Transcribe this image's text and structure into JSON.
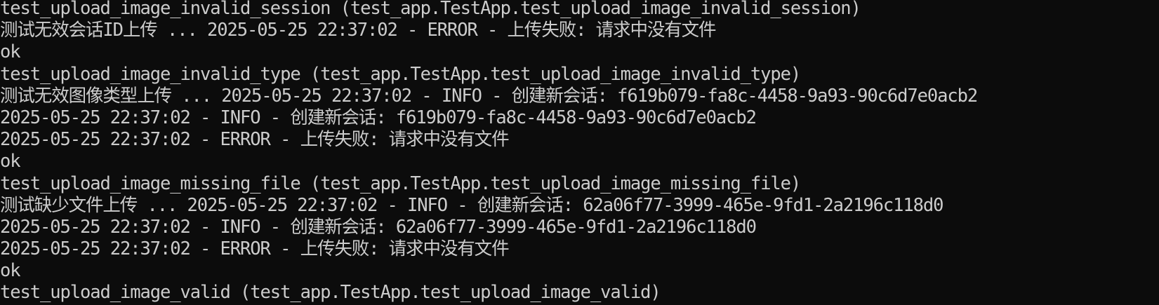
{
  "terminal": {
    "lines": [
      "test_upload_image_invalid_session (test_app.TestApp.test_upload_image_invalid_session)",
      "测试无效会话ID上传 ... 2025-05-25 22:37:02 - ERROR - 上传失败: 请求中没有文件",
      "ok",
      "test_upload_image_invalid_type (test_app.TestApp.test_upload_image_invalid_type)",
      "测试无效图像类型上传 ... 2025-05-25 22:37:02 - INFO - 创建新会话: f619b079-fa8c-4458-9a93-90c6d7e0acb2",
      "2025-05-25 22:37:02 - INFO - 创建新会话: f619b079-fa8c-4458-9a93-90c6d7e0acb2",
      "2025-05-25 22:37:02 - ERROR - 上传失败: 请求中没有文件",
      "ok",
      "test_upload_image_missing_file (test_app.TestApp.test_upload_image_missing_file)",
      "测试缺少文件上传 ... 2025-05-25 22:37:02 - INFO - 创建新会话: 62a06f77-3999-465e-9fd1-2a2196c118d0",
      "2025-05-25 22:37:02 - INFO - 创建新会话: 62a06f77-3999-465e-9fd1-2a2196c118d0",
      "2025-05-25 22:37:02 - ERROR - 上传失败: 请求中没有文件",
      "ok",
      "test_upload_image_valid (test_app.TestApp.test_upload_image_valid)"
    ]
  }
}
